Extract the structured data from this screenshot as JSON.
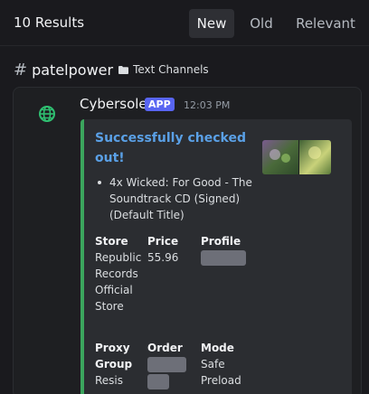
{
  "header": {
    "results_count": "10 Results",
    "tabs": [
      {
        "label": "New",
        "active": true
      },
      {
        "label": "Old",
        "active": false
      },
      {
        "label": "Relevant",
        "active": false
      }
    ]
  },
  "channel": {
    "hash_icon": "hash-icon",
    "name": "patelpower",
    "folder_icon": "folder-icon",
    "category": "Text Channels"
  },
  "message": {
    "author": "Cybersole",
    "badge": "APP",
    "timestamp": "12:03 PM",
    "avatar_icon": "globe-logo-icon",
    "embed": {
      "accent_color": "#3ba55d",
      "title": "Successfully checked out!",
      "items": [
        "4x Wicked: For Good - The Soundtrack CD (Signed) (Default Title)"
      ],
      "fields": [
        {
          "name": "Store",
          "value": "Republic Records Official Store"
        },
        {
          "name": "Price",
          "value": "55.96"
        },
        {
          "name": "Profile",
          "value": ""
        },
        {
          "name": "Proxy Group",
          "value": "Resis"
        },
        {
          "name": "Order",
          "value": ""
        },
        {
          "name": "Mode",
          "value": "Safe Preload"
        }
      ]
    }
  }
}
